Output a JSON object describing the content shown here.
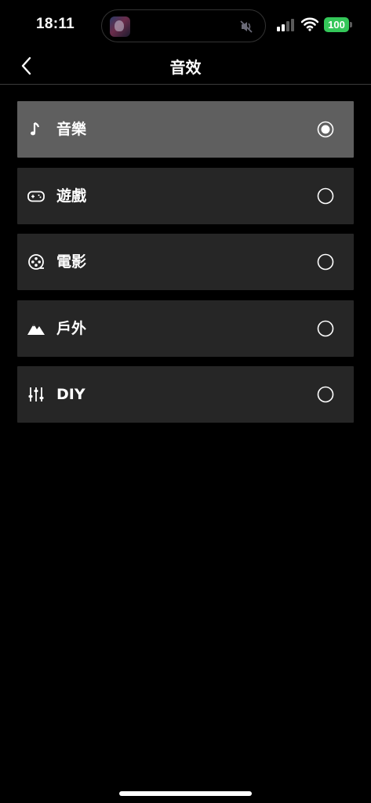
{
  "status_bar": {
    "time": "18:11",
    "battery": "100",
    "battery_color": "#34c759",
    "icons": [
      "now-playing-artwork",
      "mute-slash-icon",
      "cellular-signal-icon",
      "wifi-icon",
      "battery-icon"
    ]
  },
  "nav": {
    "back_icon": "chevron-left-icon",
    "title": "音效"
  },
  "options": [
    {
      "label": "音樂",
      "icon": "music-note-icon",
      "selected": true
    },
    {
      "label": "遊戲",
      "icon": "gamepad-icon",
      "selected": false
    },
    {
      "label": "電影",
      "icon": "film-reel-icon",
      "selected": false
    },
    {
      "label": "戶外",
      "icon": "mountain-icon",
      "selected": false
    },
    {
      "label": "DIY",
      "icon": "equalizer-sliders-icon",
      "selected": false
    }
  ],
  "colors": {
    "background": "#000000",
    "row": "#262626",
    "row_selected": "#5f5f5f"
  }
}
